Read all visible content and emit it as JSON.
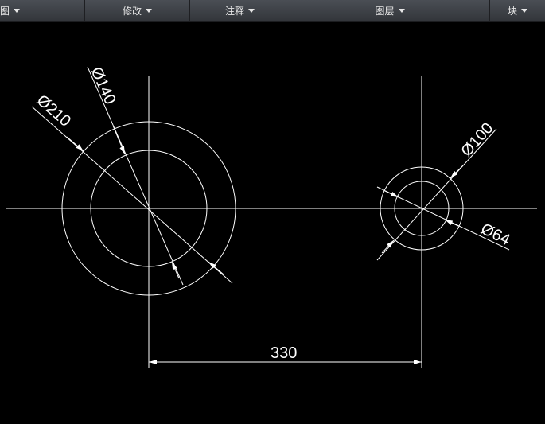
{
  "ribbon": {
    "panels": [
      {
        "label": "图"
      },
      {
        "label": "修改"
      },
      {
        "label": "注释"
      },
      {
        "label": "图层"
      },
      {
        "label": "块"
      }
    ]
  },
  "drawing": {
    "dimensions": {
      "d210": "Ø210",
      "d140": "Ø140",
      "d100": "Ø100",
      "d64": "Ø64",
      "linear": "330"
    }
  }
}
